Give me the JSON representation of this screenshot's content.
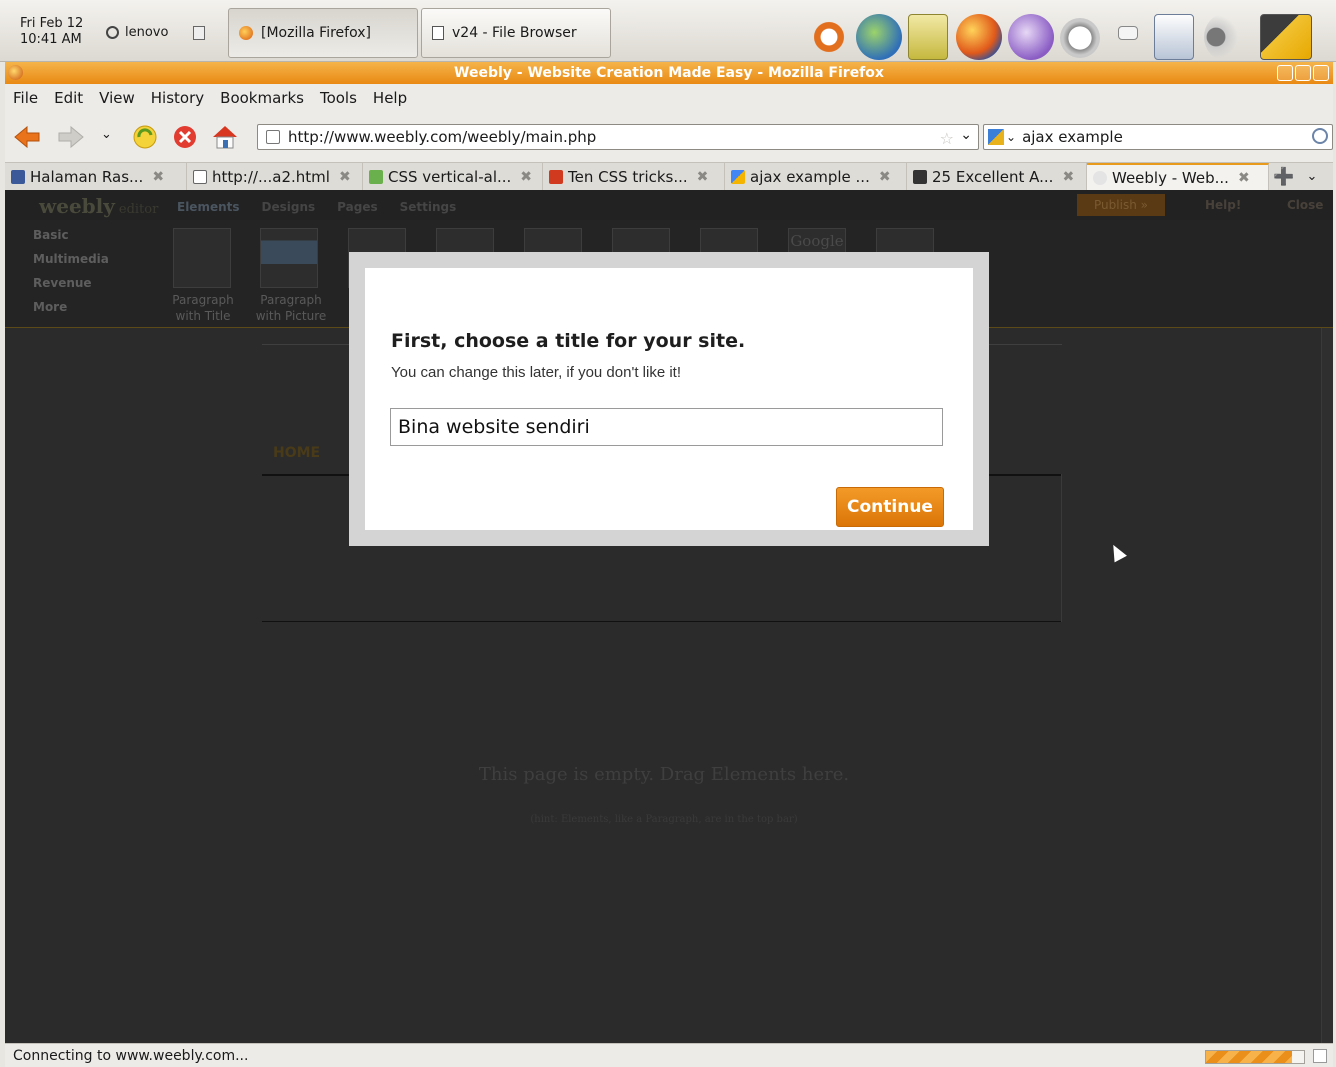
{
  "panel": {
    "clock": "Fri Feb 12\n10:41 AM",
    "clock_day": "Fri Feb 12",
    "clock_time": "10:41 AM",
    "user": "lenovo",
    "taskbar": [
      "[Mozilla Firefox]",
      "v24 - File Browser"
    ]
  },
  "window": {
    "title": "Weebly - Website Creation Made Easy - Mozilla Firefox"
  },
  "menu": [
    "File",
    "Edit",
    "View",
    "History",
    "Bookmarks",
    "Tools",
    "Help"
  ],
  "nav": {
    "url": "http://www.weebly.com/weebly/main.php",
    "search": "ajax example"
  },
  "tabs": [
    {
      "label": "Halaman Ras...",
      "color": "#3b5998"
    },
    {
      "label": "http://...a2.html",
      "color": "#888888"
    },
    {
      "label": "CSS vertical-al...",
      "color": "#6ab04c"
    },
    {
      "label": "Ten CSS tricks...",
      "color": "#d13a1e"
    },
    {
      "label": "ajax example ...",
      "color": "#4285f4"
    },
    {
      "label": "25 Excellent A...",
      "color": "#333333"
    },
    {
      "label": "Weebly - Web...",
      "color": "#c9c9c9"
    }
  ],
  "weebly": {
    "logo": "weebly",
    "logo_suffix": "editor",
    "top_tabs": [
      "Elements",
      "Designs",
      "Pages",
      "Settings"
    ],
    "publish": "Publish »",
    "help": "Help!",
    "close": "Close",
    "categories": [
      "Basic",
      "Multimedia",
      "Revenue",
      "More"
    ],
    "element_labels": [
      "Paragraph\nwith Title",
      "Paragraph\nwith Picture"
    ],
    "element_label_1": "Paragraph",
    "element_label_1b": "with Title",
    "element_label_2": "Paragraph",
    "element_label_2b": "with Picture",
    "google_thumb": "Google",
    "home_nav": "HOME",
    "empty_title": "This page is empty. Drag Elements here.",
    "empty_hint": "(hint: Elements, like a Paragraph, are in the top bar)"
  },
  "modal": {
    "title": "First, choose a title for your site.",
    "subtitle": "You can change this later, if you don't like it!",
    "input_value": "Bina website sendiri",
    "button": "Continue",
    "accent": "#e8850f"
  },
  "status": {
    "text": "Connecting to www.weebly.com..."
  }
}
